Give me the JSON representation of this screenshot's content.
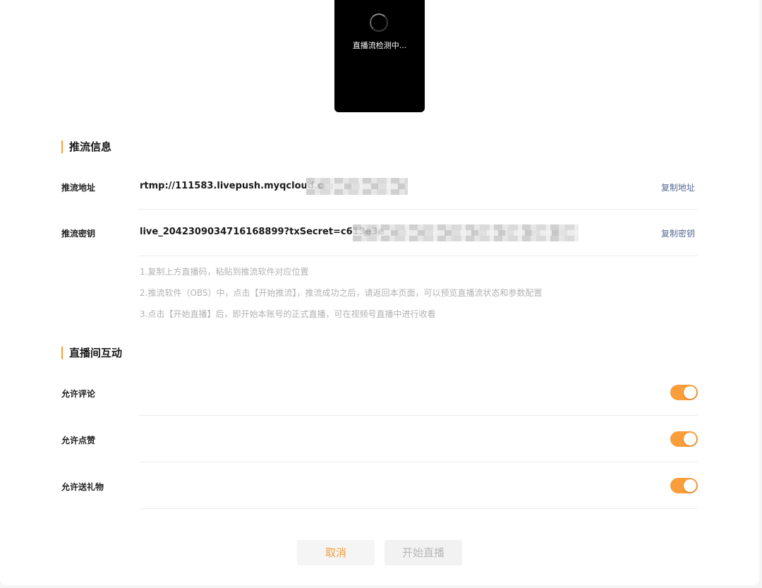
{
  "preview": {
    "status_text": "直播流检测中..."
  },
  "push_info": {
    "title": "推流信息",
    "address": {
      "label": "推流地址",
      "value": "rtmp://111583.livepush.myqcloud.c",
      "copy_label": "复制地址"
    },
    "key": {
      "label": "推流密钥",
      "value": "live_2042309034716168899?txSecret=c613e3e",
      "copy_label": "复制密钥"
    },
    "hints": [
      "1.复制上方直播码，粘贴到推流软件对应位置",
      "2.推流软件（OBS）中，点击【开始推流】，推流成功之后，请返回本页面，可以预览直播流状态和参数配置",
      "3.点击【开始直播】后，即开始本账号的正式直播，可在视频号直播中进行收看"
    ]
  },
  "interaction": {
    "title": "直播间互动",
    "items": [
      {
        "label": "允许评论",
        "enabled": true
      },
      {
        "label": "允许点赞",
        "enabled": true
      },
      {
        "label": "允许送礼物",
        "enabled": true
      }
    ]
  },
  "actions": {
    "cancel_label": "取消",
    "start_label": "开始直播"
  },
  "colors": {
    "accent": "#fa9d3b",
    "link": "#576b95"
  }
}
